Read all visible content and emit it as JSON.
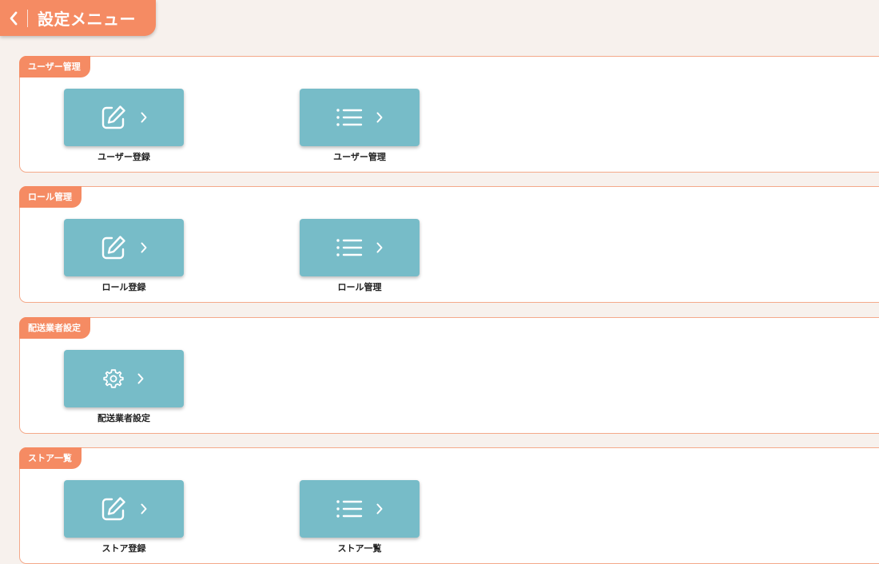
{
  "header": {
    "title": "設定メニュー",
    "back_icon": "chevron-left-icon"
  },
  "sections": [
    {
      "label": "ユーザー管理",
      "tiles": [
        {
          "label": "ユーザー登録",
          "icon": "edit-icon"
        },
        {
          "label": "ユーザー管理",
          "icon": "list-icon"
        }
      ]
    },
    {
      "label": "ロール管理",
      "tiles": [
        {
          "label": "ロール登録",
          "icon": "edit-icon"
        },
        {
          "label": "ロール管理",
          "icon": "list-icon"
        }
      ]
    },
    {
      "label": "配送業者設定",
      "tiles": [
        {
          "label": "配送業者設定",
          "icon": "gear-icon"
        }
      ]
    },
    {
      "label": "ストア一覧",
      "tiles": [
        {
          "label": "ストア登録",
          "icon": "edit-icon"
        },
        {
          "label": "ストア一覧",
          "icon": "list-icon"
        }
      ]
    }
  ],
  "colors": {
    "accent": "#f58b63",
    "tile": "#77bcc8",
    "background": "#f7f1ed",
    "section_border": "#f4a98a"
  }
}
